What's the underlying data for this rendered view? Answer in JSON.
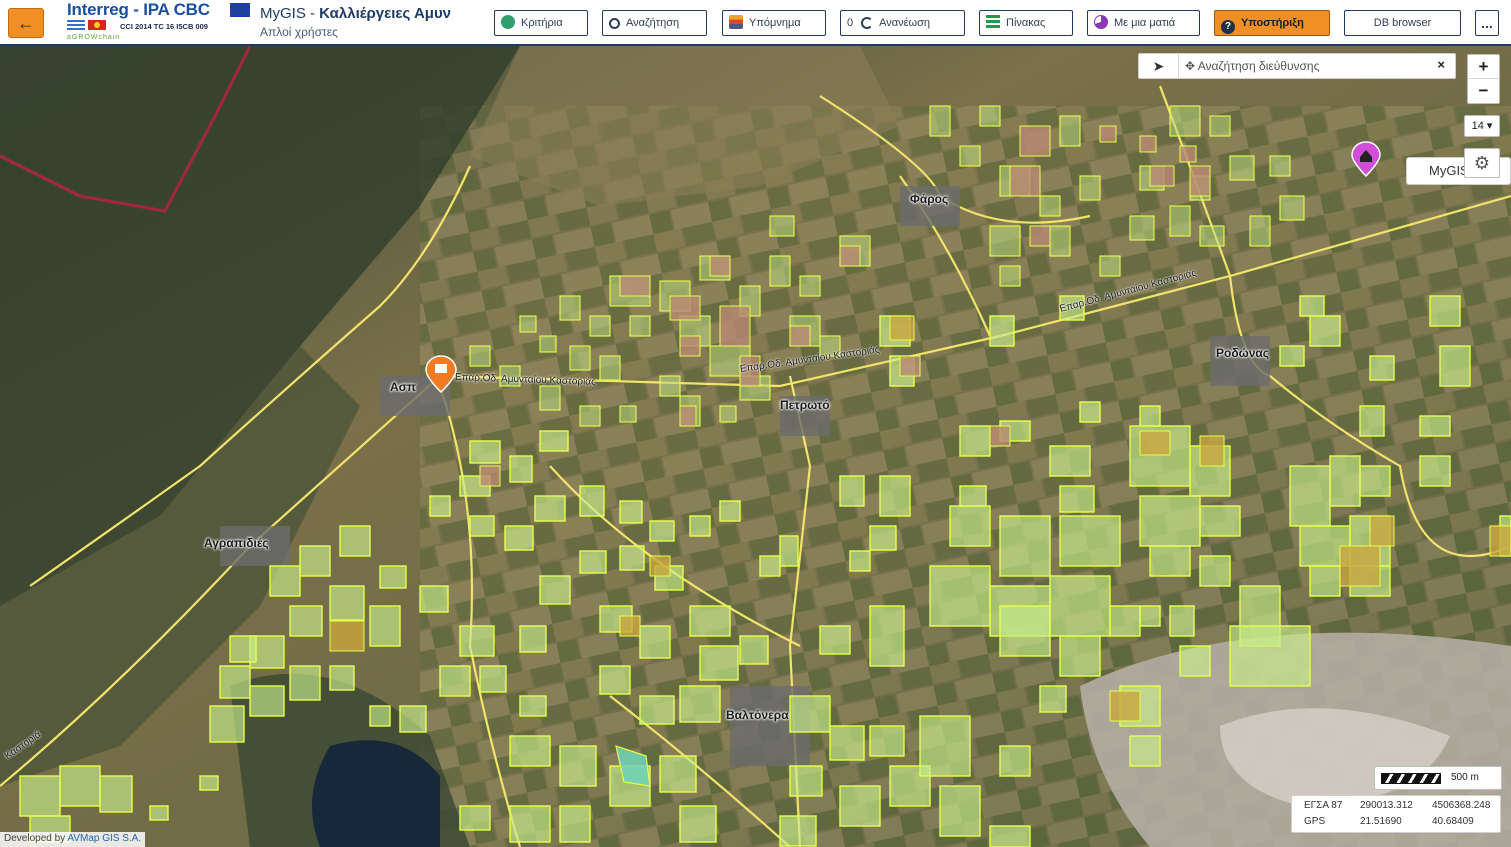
{
  "header": {
    "back_icon": "arrow-left-icon",
    "brand_title": "Interreg - IPA CBC",
    "brand_code": "CCI 2014 TC 16 I5CB 009",
    "brand_sub": "aGROWchain",
    "title_prefix": "MyGIS - ",
    "title_bold": "Καλλιέργειες Αμυν",
    "subtitle": "Απλοί χρήστες",
    "toolbar": {
      "criteria": "Κριτήρια",
      "search": "Αναζήτηση",
      "legend": "Υπόμνημα",
      "refresh_count": "0",
      "refresh": "Ανανέωση",
      "table": "Πίνακας",
      "glance": "Με μια ματιά",
      "support": "Υποστήριξη",
      "db_browser": "DB browser",
      "more": "..."
    }
  },
  "map": {
    "address_search": {
      "placeholder": "✥ Αναζήτηση διεύθυνσης",
      "clear": "×",
      "locate_icon": "navigation-arrow-icon"
    },
    "zoom_in": "+",
    "zoom_out": "−",
    "zoom_level": "14 ▾",
    "mygis_label": "MyGIS",
    "settings_icon": "gear-icon",
    "scale_label": "500 m",
    "coords": {
      "crs1": "ΕΓΣΑ 87",
      "crs1_x": "290013.312",
      "crs1_y": "4506368.248",
      "crs2": "GPS",
      "crs2_x": "21.51690",
      "crs2_y": "40.68409"
    },
    "credit_prefix": "Developed by ",
    "credit_link": "AVMap GIS S.A.",
    "places": {
      "p1": "Ασπ",
      "p2": "Πετρωτό",
      "p3": "Ροδώνας",
      "p4": "Αγραπιδιές",
      "p5": "Βαλτόνερα",
      "p6": "Φάρος"
    },
    "roads": {
      "r1": "Επαρ.Οδ. Αμυνταίου Καστοριάς",
      "r2": "Επαρ.Οδ. Αμυνταίου Καστοριάς",
      "r3": "Επαρ.Οδ. Αμυνταίου Καστοριάς",
      "r4": "Καστοριά"
    },
    "colors": {
      "parcel_green": "#c8ec8a",
      "parcel_brown": "#b98a74",
      "parcel_olive": "#c9a640",
      "road_yellow": "#f1e36b",
      "boundary_red": "#a3263f"
    }
  }
}
